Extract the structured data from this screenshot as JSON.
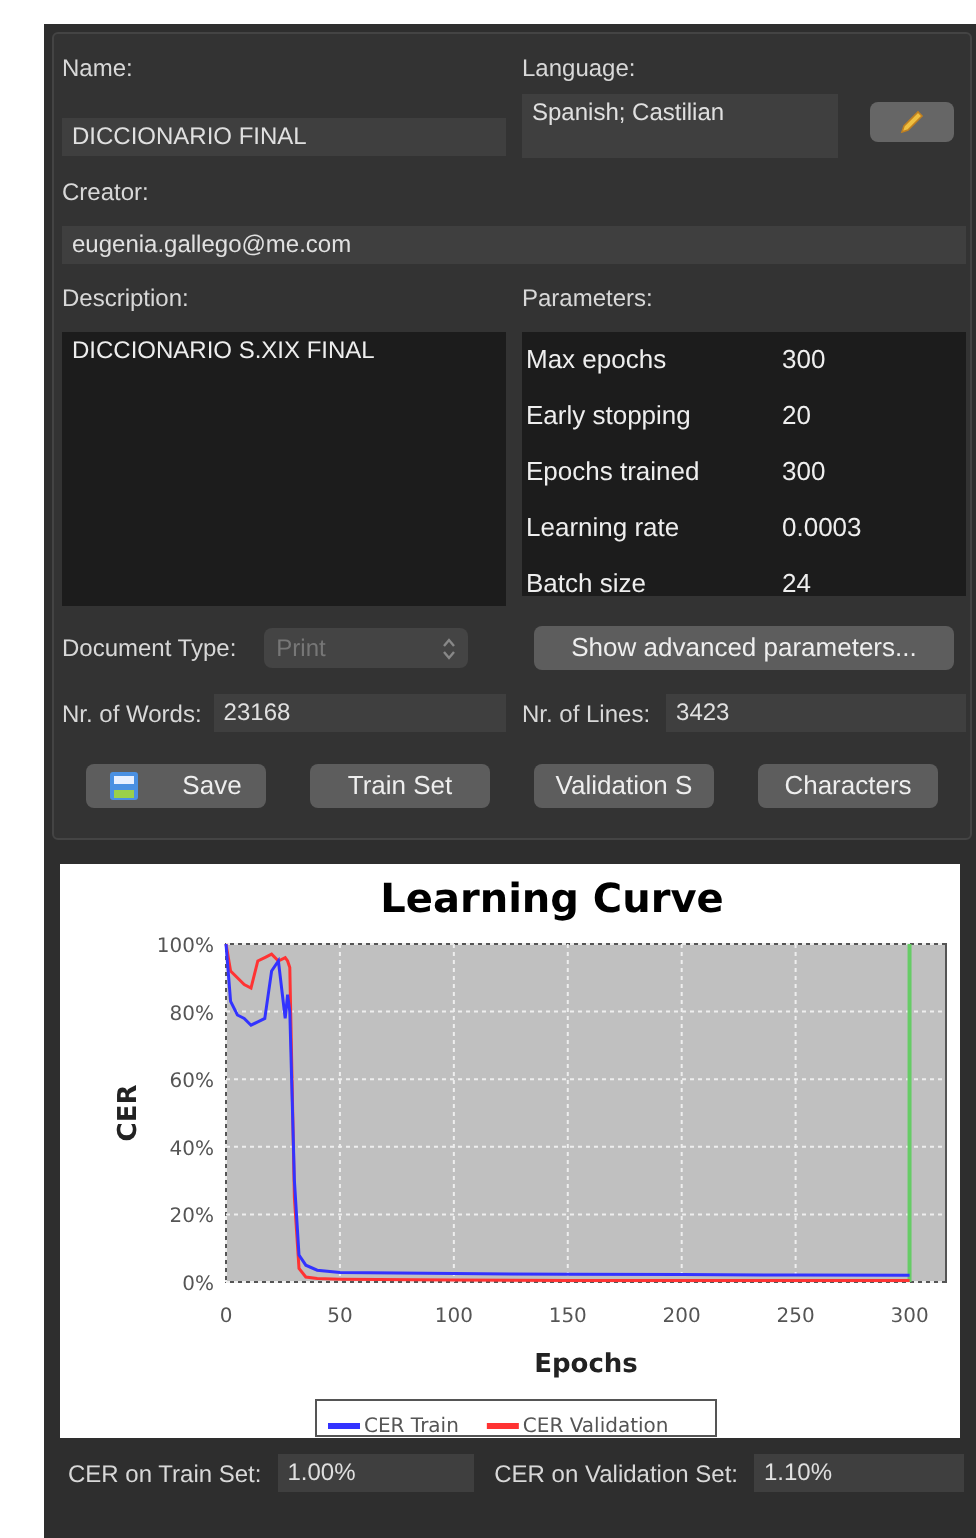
{
  "form": {
    "name_label": "Name:",
    "name": "DICCIONARIO FINAL",
    "language_label": "Language:",
    "language": "Spanish; Castilian",
    "creator_label": "Creator:",
    "creator": "eugenia.gallego@me.com",
    "description_label": "Description:",
    "description": "DICCIONARIO S.XIX FINAL",
    "parameters_label": "Parameters:",
    "parameters": [
      {
        "label": "Max epochs",
        "value": "300"
      },
      {
        "label": "Early stopping",
        "value": "20"
      },
      {
        "label": "Epochs trained",
        "value": "300"
      },
      {
        "label": "Learning rate",
        "value": "0.0003"
      },
      {
        "label": "Batch size",
        "value": "24"
      }
    ],
    "document_type_label": "Document Type:",
    "document_type": {
      "value": "Print",
      "disabled": true
    },
    "advanced_button": "Show advanced parameters...",
    "words_label": "Nr. of Words:",
    "words": "23168",
    "lines_label": "Nr. of Lines:",
    "lines": "3423",
    "buttons": [
      {
        "label": "Save",
        "kind": "save"
      },
      {
        "label": "Train Set",
        "kind": "plain"
      },
      {
        "label": "Validation S",
        "kind": "plain"
      },
      {
        "label": "Characters",
        "kind": "plain"
      }
    ]
  },
  "chart": {
    "chart_data": {
      "type": "line",
      "title": "Learning Curve",
      "xlabel": "Epochs",
      "ylabel": "CER",
      "x": [
        0,
        2,
        5,
        8,
        11,
        14,
        17,
        20,
        23,
        26,
        27,
        28,
        30,
        32,
        35,
        40,
        50,
        100,
        150,
        200,
        250,
        300
      ],
      "series": [
        {
          "name": "CER Train",
          "color": "#3333ff",
          "values": [
            100,
            83,
            79,
            78,
            76,
            77,
            78,
            92,
            95,
            78,
            85,
            80,
            30,
            8,
            5,
            3.5,
            2.8,
            2.5,
            2.3,
            2.2,
            2.1,
            2.0
          ]
        },
        {
          "name": "CER Validation",
          "color": "#ff3333",
          "values": [
            100,
            92,
            90,
            88,
            87,
            95,
            96,
            97,
            95,
            96,
            95,
            93,
            25,
            4,
            1.5,
            1,
            0.8,
            0.6,
            0.5,
            0.5,
            0.4,
            0.4
          ]
        }
      ],
      "grid": true,
      "legend": "bottom",
      "xlim": [
        0,
        316
      ],
      "ylim": [
        0,
        100
      ],
      "xticks": [
        0,
        50,
        100,
        150,
        200,
        250,
        300
      ],
      "yticks": [
        {
          "value": 0,
          "label": "0%"
        },
        {
          "value": 20,
          "label": "20%"
        },
        {
          "value": 40,
          "label": "40%"
        },
        {
          "value": 60,
          "label": "60%"
        },
        {
          "value": 80,
          "label": "80%"
        },
        {
          "value": 100,
          "label": "100%"
        }
      ],
      "ref_lines": [
        {
          "axis": "x",
          "value": 300,
          "color": "#66cc66"
        }
      ]
    }
  },
  "results": [
    {
      "label": "CER on Train Set:",
      "value": "1.00%"
    },
    {
      "label": "CER on Validation Set:",
      "value": "1.10%"
    }
  ]
}
